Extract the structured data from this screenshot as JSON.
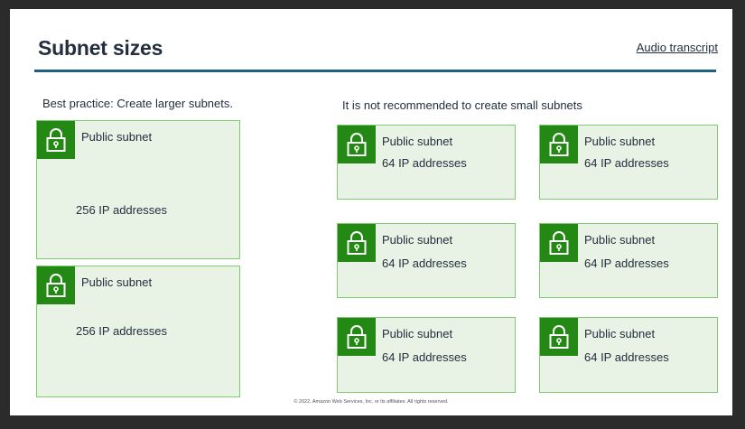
{
  "header": {
    "title": "Subnet sizes",
    "transcript_link": "Audio transcript"
  },
  "left": {
    "caption": "Best practice: Create larger subnets.",
    "subnets": [
      {
        "title": "Public subnet",
        "ips": "256 IP addresses"
      },
      {
        "title": "Public subnet",
        "ips": "256 IP addresses"
      }
    ]
  },
  "right": {
    "caption": "It is not recommended to create small subnets",
    "subnets": [
      {
        "title": "Public subnet",
        "ips": "64 IP addresses"
      },
      {
        "title": "Public subnet",
        "ips": "64 IP addresses"
      },
      {
        "title": "Public subnet",
        "ips": "64 IP addresses"
      },
      {
        "title": "Public subnet",
        "ips": "64 IP addresses"
      },
      {
        "title": "Public subnet",
        "ips": "64 IP addresses"
      },
      {
        "title": "Public subnet",
        "ips": "64 IP addresses"
      }
    ]
  },
  "icons": {
    "subnet": "lock-icon"
  },
  "colors": {
    "icon_bg": "#248814",
    "subnet_bg": "#e8f3e6",
    "subnet_border": "#7ccd6c",
    "rule": "#1f5f82"
  },
  "footer": "© 2022, Amazon Web Services, Inc. or its affiliates. All rights reserved."
}
